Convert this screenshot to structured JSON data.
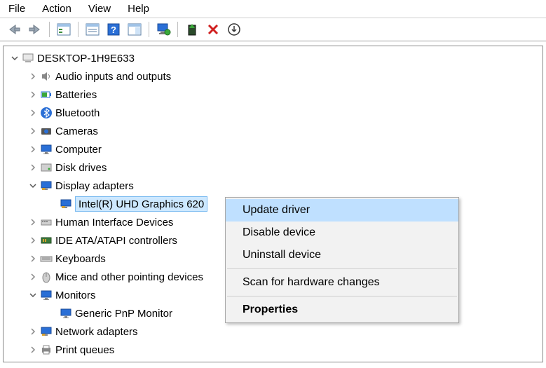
{
  "menu": {
    "file": "File",
    "action": "Action",
    "view": "View",
    "help": "Help"
  },
  "tree": {
    "root": "DESKTOP-1H9E633",
    "audio": "Audio inputs and outputs",
    "batteries": "Batteries",
    "bluetooth": "Bluetooth",
    "cameras": "Cameras",
    "computer": "Computer",
    "diskdrives": "Disk drives",
    "displayadapters": "Display adapters",
    "intelgfx": "Intel(R) UHD Graphics 620",
    "hid": "Human Interface Devices",
    "ide": "IDE ATA/ATAPI controllers",
    "keyboards": "Keyboards",
    "mice": "Mice and other pointing devices",
    "monitors": "Monitors",
    "genericpnp": "Generic PnP Monitor",
    "network": "Network adapters",
    "printqueues": "Print queues"
  },
  "context": {
    "update": "Update driver",
    "disable": "Disable device",
    "uninstall": "Uninstall device",
    "scan": "Scan for hardware changes",
    "properties": "Properties"
  }
}
